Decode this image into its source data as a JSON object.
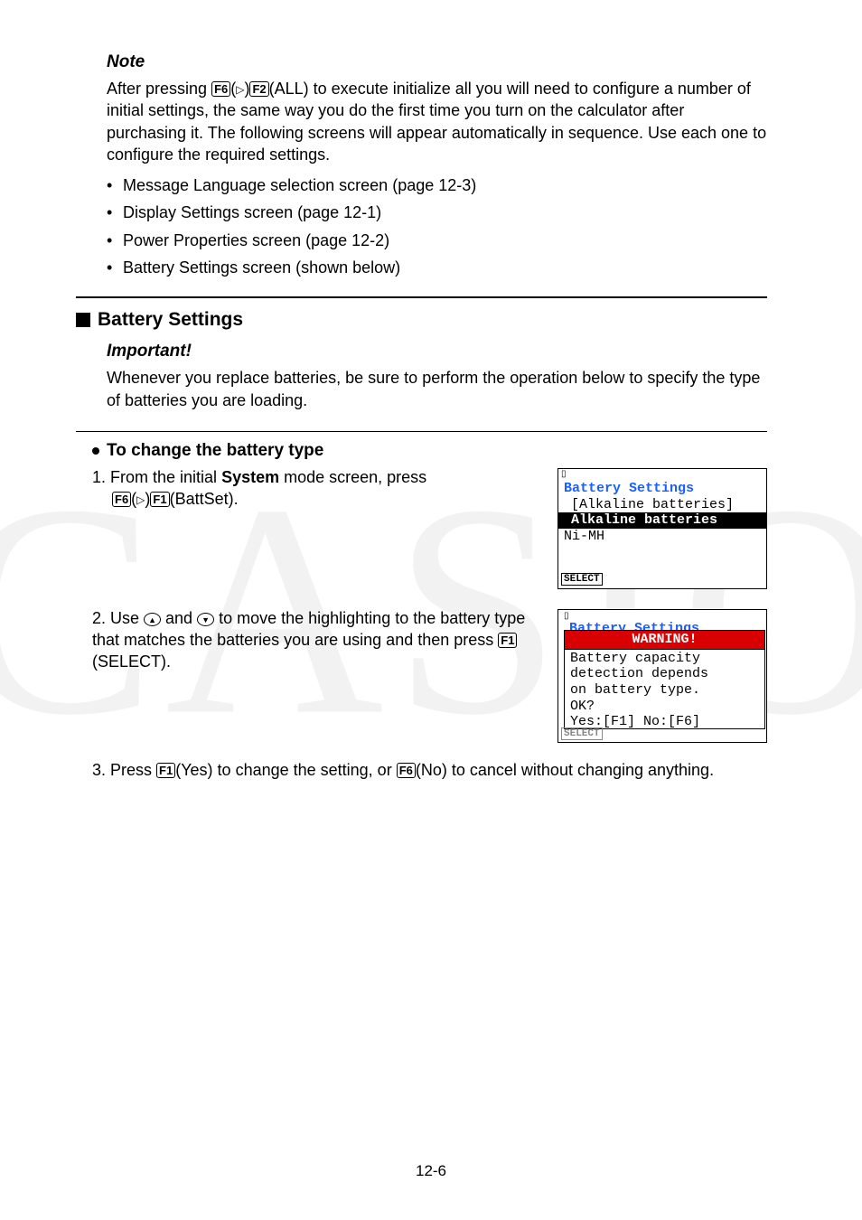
{
  "watermark": "CASIO",
  "note": {
    "heading": "Note",
    "para_before_keys": "After pressing ",
    "key1": "F6",
    "tri": "▷",
    "key2": "F2",
    "key2_label": "(ALL)",
    "para_after_keys": " to execute initialize all you will need to configure a number of initial settings, the same way you do the first time you turn on the calculator after purchasing it. The following screens will appear automatically in sequence. Use each one to configure the required settings.",
    "bullets": [
      "Message Language selection screen (page 12-3)",
      "Display Settings screen (page 12-1)",
      "Power Properties screen (page 12-2)",
      "Battery Settings screen (shown below)"
    ]
  },
  "section": {
    "heading": "Battery Settings",
    "important_label": "Important!",
    "important_text": "Whenever you replace batteries, be sure to perform the operation below to specify the type of batteries you are loading."
  },
  "sub": {
    "heading": "To change the battery type",
    "step1_a": "1. From the initial ",
    "step1_bold": "System",
    "step1_b": " mode screen, press",
    "step1_key1": "F6",
    "step1_tri": "▷",
    "step1_key2": "F1",
    "step1_key2_label": "(BattSet).",
    "step2_a": "2. Use ",
    "step2_up": "▲",
    "step2_mid": " and ",
    "step2_down": "▼",
    "step2_b": " to move the highlighting to the battery type that matches the batteries you are using and then press ",
    "step2_key": "F1",
    "step2_key_label": "(SELECT).",
    "step3_a": "3. Press ",
    "step3_key1": "F1",
    "step3_mid": "(Yes) to change the setting, or ",
    "step3_key2": "F6",
    "step3_b": "(No) to cancel without changing anything."
  },
  "screen1": {
    "title": "Battery Settings",
    "sub": "[Alkaline batteries]",
    "hl": "Alkaline batteries ",
    "line": "Ni-MH",
    "softkey": "SELECT"
  },
  "screen2": {
    "title": "Battery Settings",
    "warn": "WARNING!",
    "body": "Battery capacity\ndetection depends\non battery type.\nOK?\nYes:[F1] No:[F6]",
    "softkey": "SELECT"
  },
  "page_num": "12-6"
}
